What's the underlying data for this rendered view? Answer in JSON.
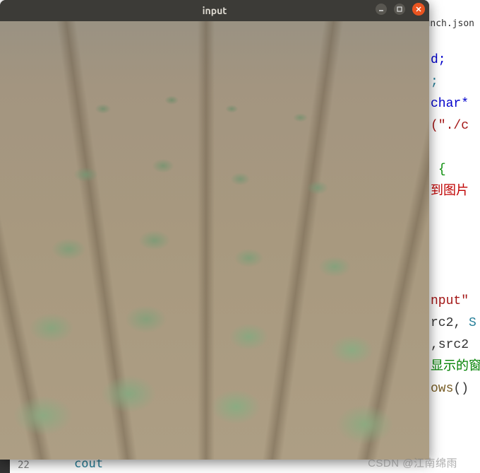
{
  "window": {
    "title": "input"
  },
  "editor": {
    "tab_filename": "aunch.json",
    "line_number": "22",
    "cout_label": "cout",
    "code": {
      "l1": "d;",
      "l2_semi": ";",
      "l3_type": "char*",
      "l4_str": "(\"./c",
      "l6_brace": "{",
      "l7_cn": "到图片",
      "l12_str": "nput\"",
      "l13_a": "rc2, ",
      "l13_b": "S",
      "l14": ",src2",
      "l15_cn": "显示的窗",
      "l16_fn": "ows",
      "l16_paren": "()"
    }
  },
  "watermark": "CSDN @江南绵雨"
}
